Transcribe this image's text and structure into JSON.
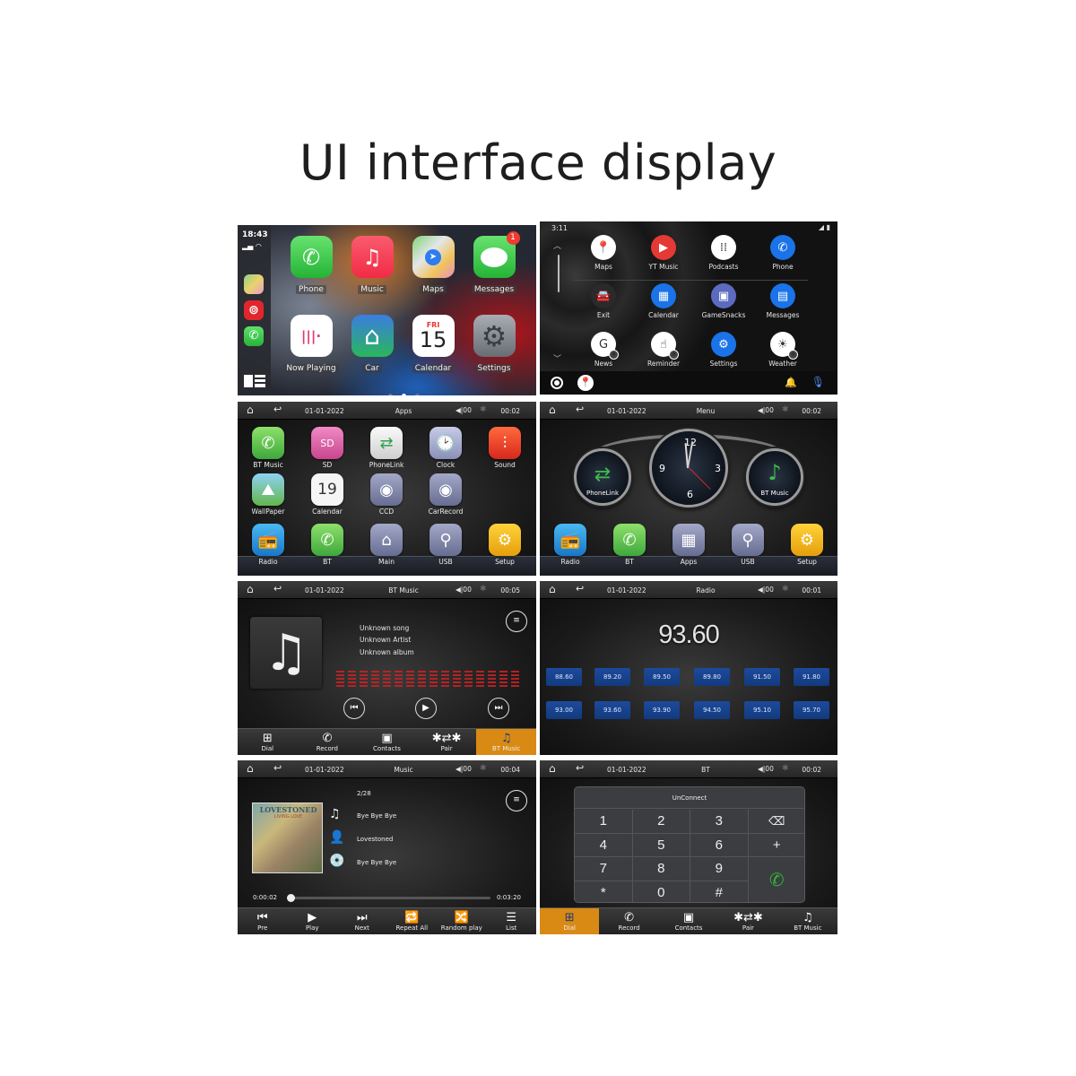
{
  "title": "UI interface display",
  "carplay": {
    "time": "18:43",
    "signal": "signal-wifi",
    "sidebar_apps": [
      {
        "name": "Maps",
        "icon": "maps-icon"
      },
      {
        "name": "NetEase Music",
        "icon": "netease-icon",
        "glyph": "⊚"
      },
      {
        "name": "Phone",
        "icon": "phone-icon",
        "glyph": "✆"
      }
    ],
    "apps": [
      {
        "label": "Phone",
        "glyph": "✆"
      },
      {
        "label": "Music",
        "glyph": "♫"
      },
      {
        "label": "Maps",
        "glyph": "➤"
      },
      {
        "label": "Messages",
        "glyph": "💬",
        "badge": "1"
      },
      {
        "label": "Now Playing",
        "glyph": "|||·"
      },
      {
        "label": "Car",
        "glyph": "⌂"
      },
      {
        "label": "Calendar",
        "day": "FRI",
        "date": "15"
      },
      {
        "label": "Settings",
        "glyph": "⚙"
      }
    ],
    "page_count": 3,
    "active_page": 2
  },
  "android_auto": {
    "time": "3:11",
    "status": "◢ ▮",
    "apps": [
      {
        "label": "Maps",
        "glyph": "📍",
        "color": "#ffffff"
      },
      {
        "label": "YT Music",
        "glyph": "▶",
        "color": "#e53935"
      },
      {
        "label": "Podcasts",
        "glyph": "⁞⁞",
        "color": "#ffffff"
      },
      {
        "label": "Phone",
        "glyph": "✆",
        "color": "#1a73e8"
      },
      {
        "label": "Exit",
        "glyph": "🚘",
        "color": "#2a2a2a"
      },
      {
        "label": "Calendar",
        "glyph": "▦",
        "color": "#1a73e8"
      },
      {
        "label": "GameSnacks",
        "glyph": "▣",
        "color": "#5c6bc0"
      },
      {
        "label": "Messages",
        "glyph": "▤",
        "color": "#1a73e8"
      },
      {
        "label": "News",
        "glyph": "G",
        "color": "#ffffff"
      },
      {
        "label": "Reminder",
        "glyph": "☝",
        "color": "#ffffff"
      },
      {
        "label": "Settings",
        "glyph": "⚙",
        "color": "#1a73e8"
      },
      {
        "label": "Weather",
        "glyph": "☀",
        "color": "#ffffff"
      }
    ],
    "bottom": {
      "home": "home-button",
      "maps": "📍",
      "bell": "🔔",
      "mic": "🎙"
    }
  },
  "apps_screen": {
    "bar": {
      "date": "01-01-2022",
      "title": "Apps",
      "volume": "◀|00",
      "bt": "✱",
      "clock": "00:02"
    },
    "apps": [
      {
        "label": "BT Music",
        "glyph": "✆",
        "style": "g-green"
      },
      {
        "label": "SD",
        "glyph": "SD",
        "style": "g-pink"
      },
      {
        "label": "PhoneLink",
        "glyph": "⇄",
        "style": "g-white"
      },
      {
        "label": "Clock",
        "glyph": "🕑",
        "style": "g-lav"
      },
      {
        "label": "Sound",
        "glyph": "⫶",
        "style": "g-red"
      },
      {
        "label": "WallPaper",
        "glyph": "⛰",
        "style": "g-sky"
      },
      {
        "label": "Calendar",
        "glyph": "19",
        "style": "g-cal"
      },
      {
        "label": "CCD",
        "glyph": "◉",
        "style": "g-slate"
      },
      {
        "label": "CarRecord",
        "glyph": "◉",
        "style": "g-slate"
      },
      {
        "label": "Radio",
        "glyph": "📻",
        "style": "g-blue"
      },
      {
        "label": "BT",
        "glyph": "✆",
        "style": "g-green"
      },
      {
        "label": "Main",
        "glyph": "⌂",
        "style": "g-slate"
      },
      {
        "label": "USB",
        "glyph": "⚲",
        "style": "g-slate"
      },
      {
        "label": "Setup",
        "glyph": "⚙",
        "style": "g-yellow"
      }
    ]
  },
  "menu_screen": {
    "bar": {
      "date": "01-01-2022",
      "title": "Menu",
      "volume": "◀|00",
      "bt": "✱",
      "clock": "00:02"
    },
    "dials": [
      {
        "label": "PhoneLink",
        "glyph": "⇄"
      },
      {
        "label": "BT Music",
        "glyph": "♪"
      }
    ],
    "clock_numbers": [
      "12",
      "3",
      "6",
      "9"
    ],
    "dock": [
      {
        "label": "Radio",
        "glyph": "📻",
        "style": "g-blue"
      },
      {
        "label": "BT",
        "glyph": "✆",
        "style": "g-green"
      },
      {
        "label": "Apps",
        "glyph": "▦",
        "style": "g-slate"
      },
      {
        "label": "USB",
        "glyph": "⚲",
        "style": "g-slate"
      },
      {
        "label": "Setup",
        "glyph": "⚙",
        "style": "g-yellow"
      }
    ]
  },
  "bt_music_screen": {
    "bar": {
      "date": "01-01-2022",
      "title": "BT Music",
      "volume": "◀|00",
      "bt": "✱",
      "clock": "00:05"
    },
    "song": "Unknown song",
    "artist": "Unknown Artist",
    "album": "Unknown album",
    "controls": {
      "prev": "⏮",
      "play": "▶",
      "next": "⏭",
      "eq": "≡"
    },
    "tabs": [
      {
        "label": "Dial",
        "glyph": "⊞",
        "active": false
      },
      {
        "label": "Record",
        "glyph": "✆",
        "active": false
      },
      {
        "label": "Contacts",
        "glyph": "▣",
        "active": false
      },
      {
        "label": "Pair",
        "glyph": "✱⇄✱",
        "active": false
      },
      {
        "label": "BT Music",
        "glyph": "♫",
        "active": true
      }
    ]
  },
  "radio_screen": {
    "bar": {
      "date": "01-01-2022",
      "title": "Radio",
      "volume": "◀|00",
      "bt": "✱",
      "clock": "00:01"
    },
    "frequency": "93.60",
    "presets": [
      "88.60",
      "89.20",
      "89.50",
      "89.80",
      "91.50",
      "91.80",
      "93.00",
      "93.60",
      "93.90",
      "94.50",
      "95.10",
      "95.70"
    ]
  },
  "music_screen": {
    "bar": {
      "date": "01-01-2022",
      "title": "Music",
      "volume": "◀|00",
      "bt": "✱",
      "clock": "00:04"
    },
    "track_index": "2/28",
    "cover_title": "LOVESTONED",
    "cover_subtitle": "LIVING LOVE",
    "title": "Bye Bye Bye",
    "artist": "Lovestoned",
    "album": "Bye Bye Bye",
    "elapsed": "0:00:02",
    "duration": "0:03:20",
    "progress_fraction": 0.01,
    "controls": [
      {
        "label": "Pre",
        "glyph": "⏮"
      },
      {
        "label": "Play",
        "glyph": "▶"
      },
      {
        "label": "Next",
        "glyph": "⏭"
      },
      {
        "label": "Repeat All",
        "glyph": "🔁"
      },
      {
        "label": "Random play",
        "glyph": "🔀"
      },
      {
        "label": "List",
        "glyph": "☰"
      }
    ]
  },
  "bt_screen": {
    "bar": {
      "date": "01-01-2022",
      "title": "BT",
      "volume": "◀|00",
      "bt": "✱",
      "clock": "00:02"
    },
    "status": "UnConnect",
    "keys": [
      "1",
      "2",
      "3",
      "⌫",
      "4",
      "5",
      "6",
      "+",
      "7",
      "8",
      "9",
      "*",
      "0",
      "#"
    ],
    "call_glyph": "✆",
    "tabs": [
      {
        "label": "Dial",
        "glyph": "⊞",
        "active": true
      },
      {
        "label": "Record",
        "glyph": "✆",
        "active": false
      },
      {
        "label": "Contacts",
        "glyph": "▣",
        "active": false
      },
      {
        "label": "Pair",
        "glyph": "✱⇄✱",
        "active": false
      },
      {
        "label": "BT Music",
        "glyph": "♫",
        "active": false
      }
    ]
  }
}
